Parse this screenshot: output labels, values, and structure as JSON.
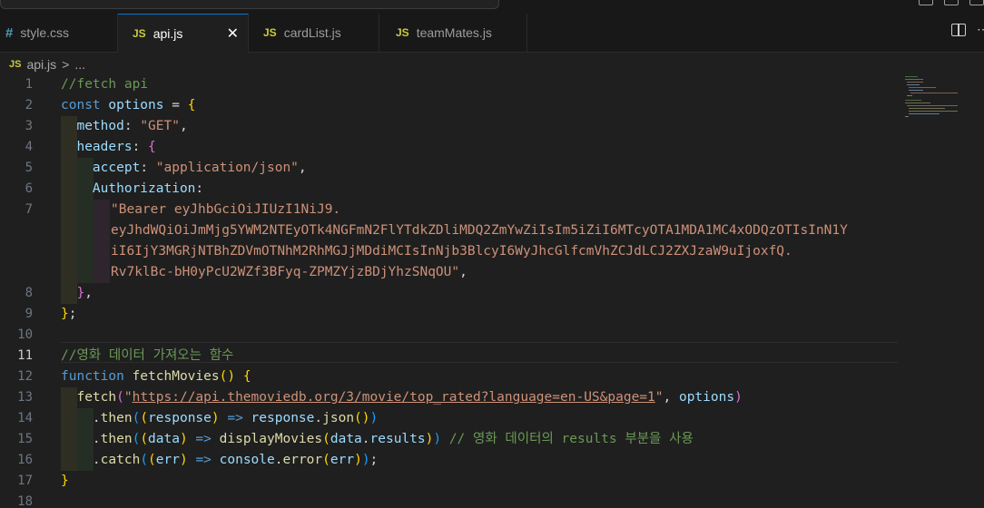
{
  "tabs": [
    {
      "icon": "#",
      "label": "style.css"
    },
    {
      "icon": "JS",
      "label": "api.js",
      "close": "✕"
    },
    {
      "icon": "JS",
      "label": "cardList.js"
    },
    {
      "icon": "JS",
      "label": "teamMates.js"
    }
  ],
  "breadcrumb": {
    "icon": "JS",
    "file": "api.js",
    "sep": ">",
    "rest": "..."
  },
  "line_numbers": [
    "1",
    "2",
    "3",
    "4",
    "5",
    "6",
    "7",
    "8",
    "9",
    "10",
    "11",
    "12",
    "13",
    "14",
    "15",
    "16",
    "17",
    "18"
  ],
  "code": {
    "l1": "//fetch api",
    "l2_kw": "const",
    "l2_var": "options",
    "l2_eq": " = ",
    "l3_prop": "method",
    "l3_val": "\"GET\"",
    "l4_prop": "headers",
    "l5_prop": "accept",
    "l5_val": "\"application/json\"",
    "l6_prop": "Authorization",
    "l7a": "\"Bearer eyJhbGciOiJIUzI1NiJ9.",
    "l7b": "eyJhdWQiOiJmMjg5YWM2NTEyOTk4NGFmN2FlYTdkZDliMDQ2ZmYwZiIsIm5iZiI6MTcyOTA1MDA1MC4xODQzOTIsInN1Y",
    "l7c": "iI6IjY3MGRjNTBhZDVmOTNhM2RhMGJjMDdiMCIsInNjb3BlcyI6WyJhcGlfcmVhZCJdLCJ2ZXJzaW9uIjoxfQ.",
    "l7d": "Rv7klBc-bH0yPcU2WZf3BFyq-ZPMZYjzBDjYhzSNqOU\"",
    "l11": "//영화 데이터 가져오는 함수",
    "l12_kw": "function",
    "l12_fn": "fetchMovies",
    "l13_fn": "fetch",
    "l13_url": "https://api.themoviedb.org/3/movie/top_rated?language=en-US&page=1",
    "l13_var": "options",
    "l14_then": "then",
    "l14_param": "response",
    "l14_obj": "response",
    "l14_json": "json",
    "l15_then": "then",
    "l15_param": "data",
    "l15_fn": "displayMovies",
    "l15_obj": "data",
    "l15_prop": "results",
    "l15_cm": "// 영화 데이터의 results 부분을 사용",
    "l16_catch": "catch",
    "l16_param": "err",
    "l16_obj": "console",
    "l16_fn": "error",
    "l16_arg": "err"
  }
}
